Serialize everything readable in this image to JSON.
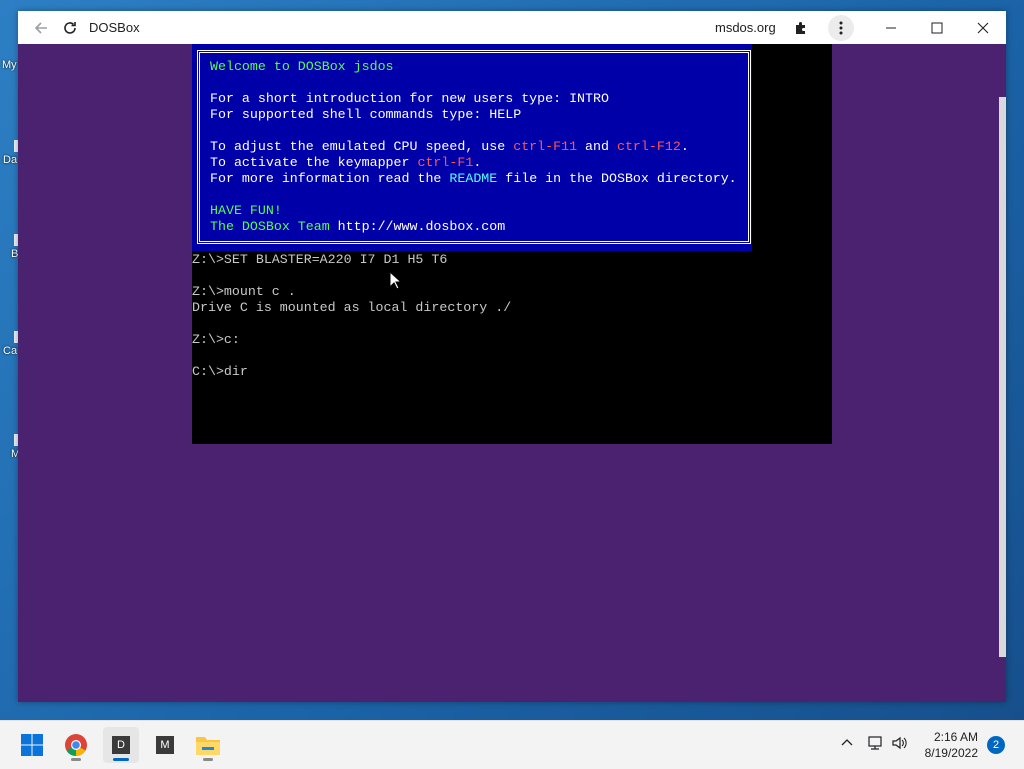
{
  "desktop": {
    "icons": [
      {
        "label": "My",
        "icon": "file-icon"
      },
      {
        "label": "Da",
        "icon": "file-icon"
      },
      {
        "label": "B",
        "icon": "file-icon"
      },
      {
        "label": "Ca",
        "icon": "file-icon"
      },
      {
        "label": "M",
        "icon": "file-icon"
      }
    ]
  },
  "window": {
    "title": "DOSBox",
    "origin": "msdos.org"
  },
  "dosbox": {
    "banner": {
      "welcome": "Welcome to DOSBox jsdos",
      "intro_line": "For a short introduction for new users type: INTRO",
      "help_line": "For supported shell commands type: HELP",
      "cpu_prefix": "To adjust the emulated CPU speed, use ",
      "cpu_key1": "ctrl-F11",
      "cpu_and": " and ",
      "cpu_key2": "ctrl-F12",
      "cpu_end": ".",
      "keymap_prefix": "To activate the keymapper ",
      "keymap_key": "ctrl-F1",
      "keymap_end": ".",
      "info_prefix": "For more information read the ",
      "info_readme": "README",
      "info_suffix": " file in the DOSBox directory.",
      "have_fun": "HAVE FUN!",
      "team_label": "The DOSBox Team ",
      "team_url": "http://www.dosbox.com"
    },
    "terminal_lines": [
      "Z:\\>SET BLASTER=A220 I7 D1 H5 T6",
      "",
      "Z:\\>mount c .",
      "Drive C is mounted as local directory ./",
      "",
      "Z:\\>c:",
      "",
      "C:\\>dir"
    ]
  },
  "taskbar": {
    "apps": [
      {
        "name": "start",
        "label": ""
      },
      {
        "name": "chrome",
        "label": ""
      },
      {
        "name": "dosbox",
        "label": "D"
      },
      {
        "name": "msdos",
        "label": "M"
      },
      {
        "name": "file-explorer",
        "label": ""
      }
    ],
    "time": "2:16 AM",
    "date": "8/19/2022",
    "notifications": "2"
  },
  "colors": {
    "dos_blue": "#0000a8",
    "window_bg": "#4b2270",
    "accent": "#0067c0"
  }
}
